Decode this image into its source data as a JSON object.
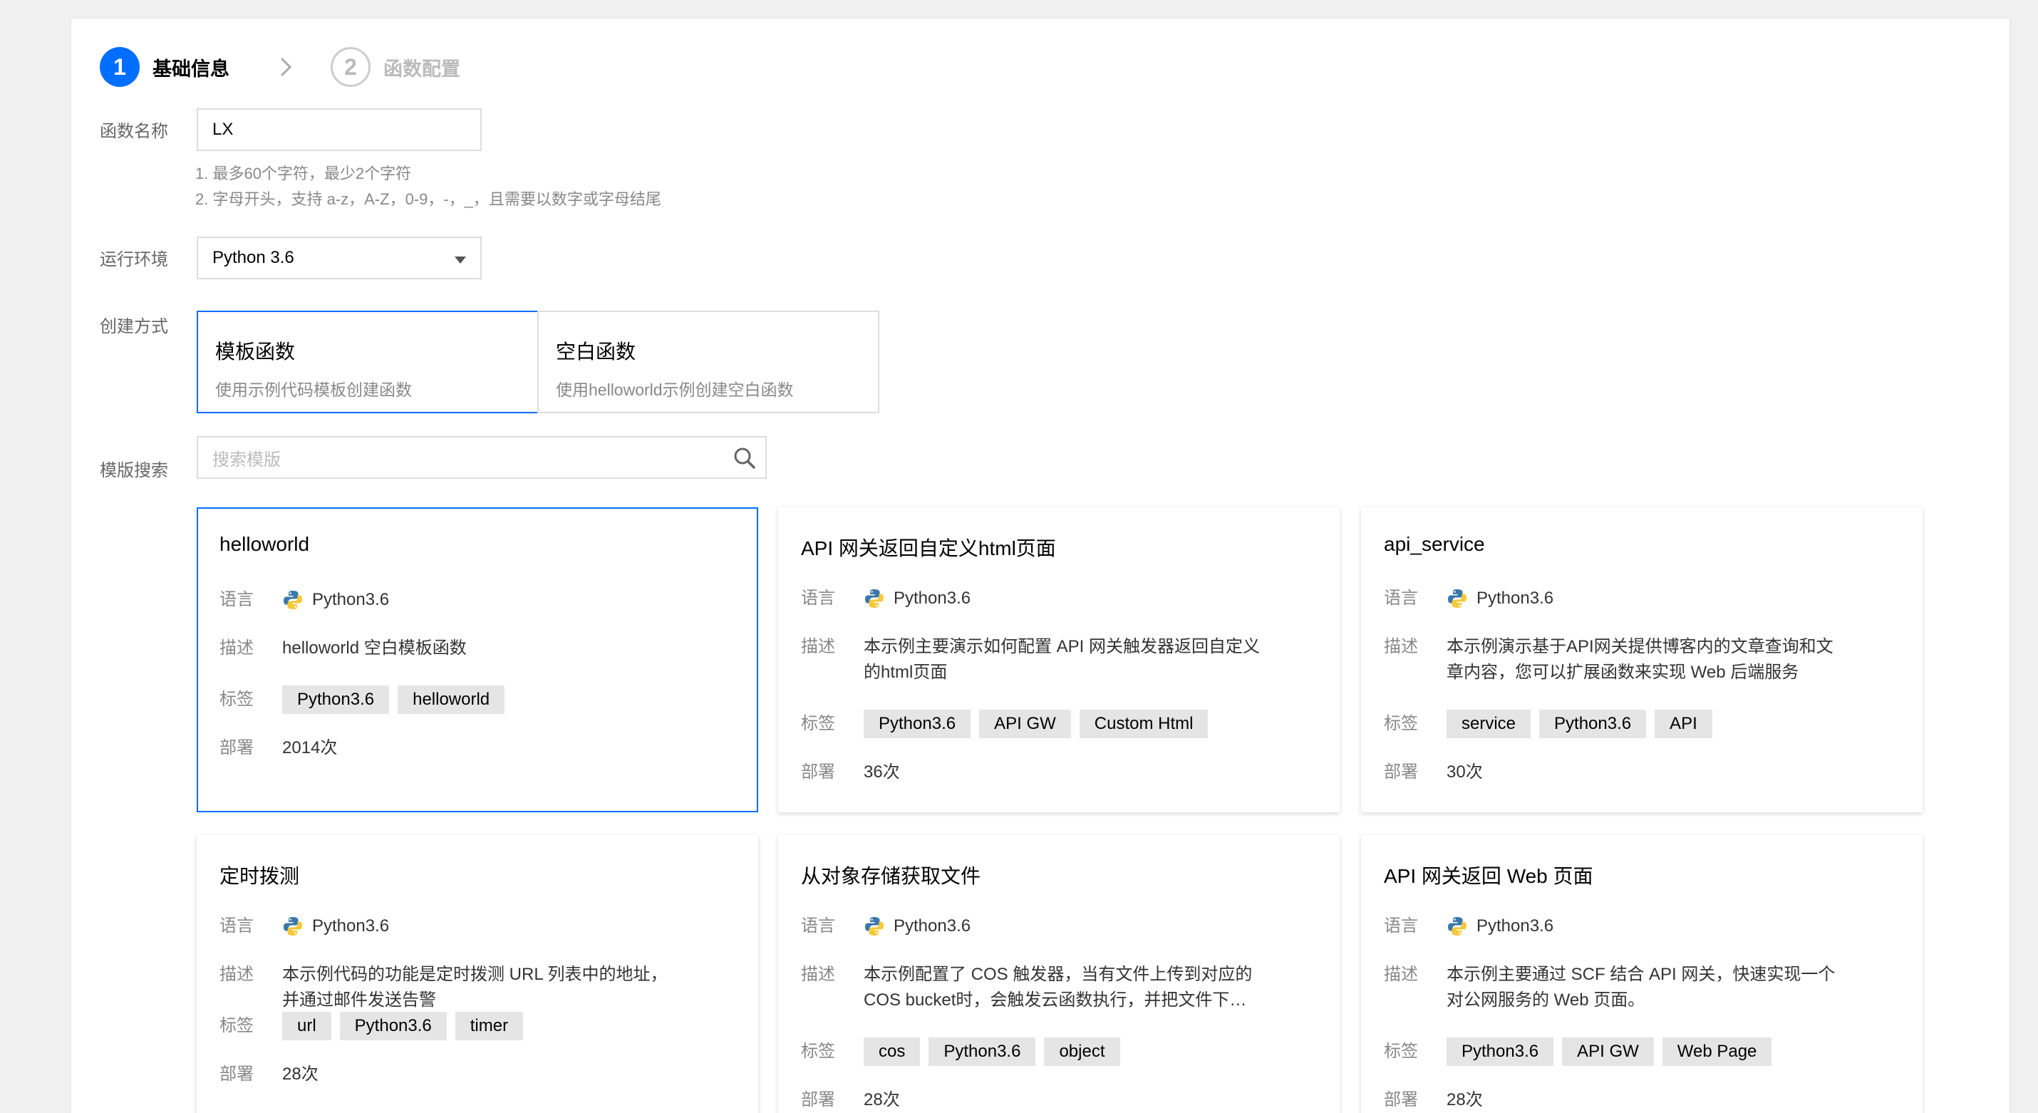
{
  "stepper": {
    "steps": [
      {
        "num": "1",
        "label": "基础信息"
      },
      {
        "num": "2",
        "label": "函数配置"
      }
    ]
  },
  "form": {
    "name_label": "函数名称",
    "name_value": "LX",
    "name_hints": [
      "1. 最多60个字符，最少2个字符",
      "2. 字母开头，支持 a-z，A-Z，0-9，-，_，且需要以数字或字母结尾"
    ],
    "runtime_label": "运行环境",
    "runtime_value": "Python 3.6",
    "method_label": "创建方式",
    "methods": [
      {
        "title": "模板函数",
        "desc": "使用示例代码模板创建函数"
      },
      {
        "title": "空白函数",
        "desc": "使用helloworld示例创建空白函数"
      }
    ],
    "search_label": "模版搜索",
    "search_placeholder": "搜索模版"
  },
  "row_labels": {
    "lang": "语言",
    "desc": "描述",
    "tags": "标签",
    "deploy": "部署"
  },
  "templates": [
    {
      "title": "helloworld",
      "lang": "Python3.6",
      "desc": "helloworld 空白模板函数",
      "tags": [
        "Python3.6",
        "helloworld"
      ],
      "deploy": "2014次"
    },
    {
      "title": "API 网关返回自定义html页面",
      "lang": "Python3.6",
      "desc": "本示例主要演示如何配置 API 网关触发器返回自定义的html页面",
      "tags": [
        "Python3.6",
        "API GW",
        "Custom Html"
      ],
      "deploy": "36次"
    },
    {
      "title": "api_service",
      "lang": "Python3.6",
      "desc": "本示例演示基于API网关提供博客内的文章查询和文章内容，您可以扩展函数来实现 Web 后端服务",
      "tags": [
        "service",
        "Python3.6",
        "API"
      ],
      "deploy": "30次"
    },
    {
      "title": "定时拨测",
      "lang": "Python3.6",
      "desc": "本示例代码的功能是定时拨测 URL 列表中的地址，并通过邮件发送告警",
      "tags": [
        "url",
        "Python3.6",
        "timer"
      ],
      "deploy": "28次"
    },
    {
      "title": "从对象存储获取文件",
      "lang": "Python3.6",
      "desc": "本示例配置了 COS 触发器，当有文件上传到对应的 COS bucket时，会触发云函数执行，并把文件下载到本地",
      "tags": [
        "cos",
        "Python3.6",
        "object"
      ],
      "deploy": "28次"
    },
    {
      "title": "API 网关返回 Web 页面",
      "lang": "Python3.6",
      "desc": "本示例主要通过 SCF 结合 API 网关，快速实现一个对公网服务的 Web 页面。",
      "tags": [
        "Python3.6",
        "API GW",
        "Web Page"
      ],
      "deploy": "28次"
    }
  ],
  "colors": {
    "accent": "#006eff",
    "tag_bg": "#e5e5e5"
  }
}
